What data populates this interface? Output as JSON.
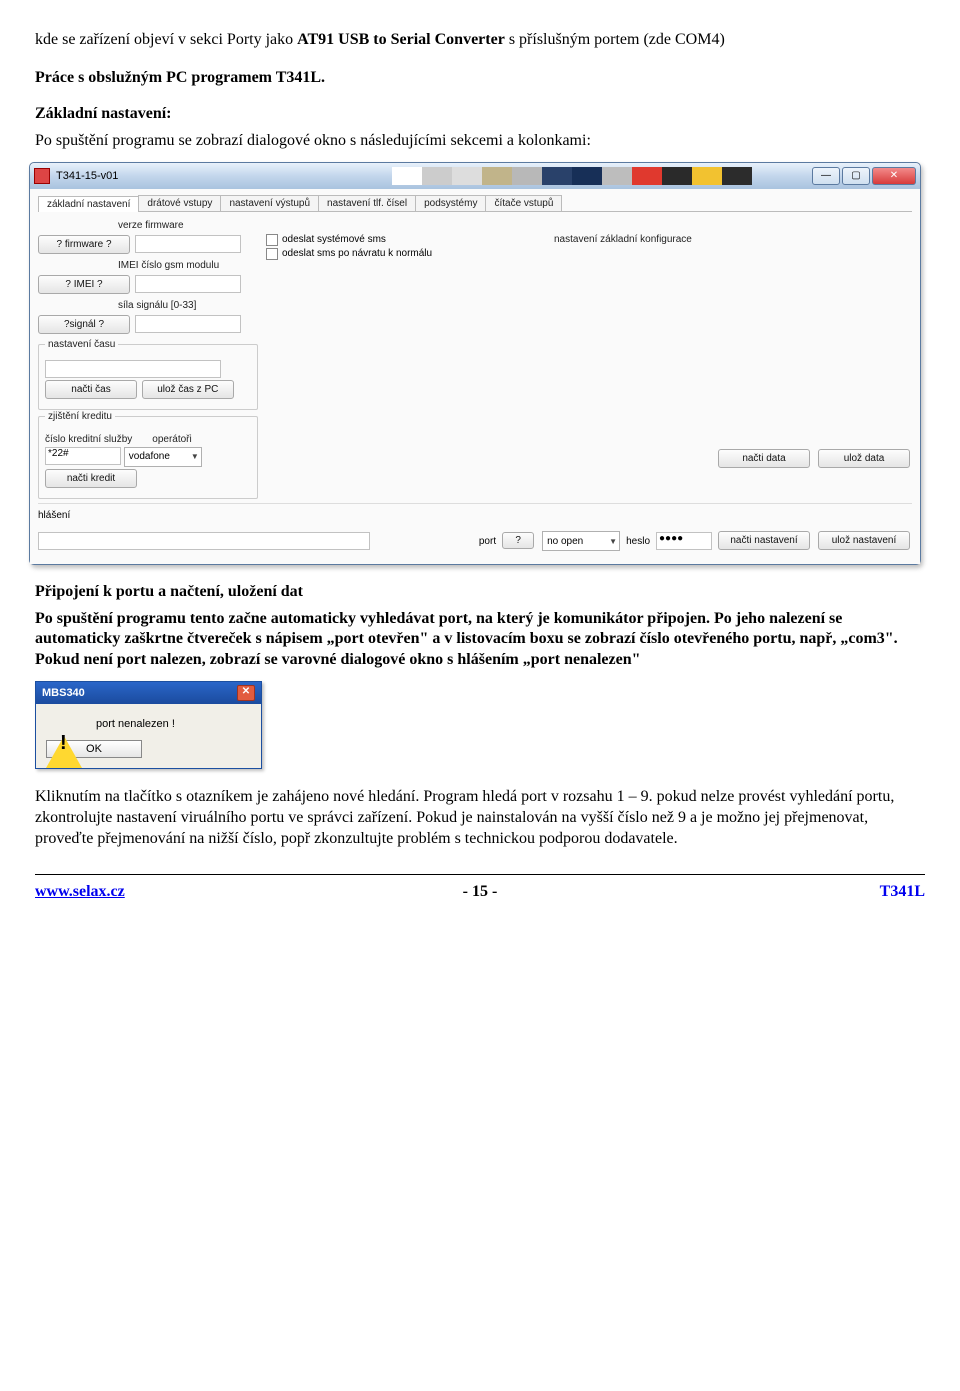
{
  "intro": {
    "line1_pre": "kde se zařízení objeví v sekci Porty jako ",
    "line1_bold": "AT91 USB to Serial Converter",
    "line1_post": " s příslušným portem (zde COM4)"
  },
  "heading1": "Práce s obslužným PC programem T341L.",
  "heading2": "Základní nastavení:",
  "para1": "Po spuštění programu se zobrazí dialogové okno s následujícími sekcemi a kolonkami:",
  "app": {
    "title": "T341-15-v01",
    "tabs": [
      "základní nastavení",
      "drátové vstupy",
      "nastavení výstupů",
      "nastavení tlf. čísel",
      "podsystémy",
      "čítače vstupů"
    ],
    "labels": {
      "verze": "verze firmware",
      "imei": "IMEI číslo gsm modulu",
      "signal": "síla signálu [0-33]",
      "cas_group": "nastavení času",
      "kredit_group": "zjištění kreditu",
      "kredit_sluzby": "číslo kreditní služby",
      "operatori": "operátoři",
      "konfig": "nastavení základní konfigurace",
      "hlaseni": "hlášení",
      "port": "port",
      "heslo": "heslo"
    },
    "buttons": {
      "firmware": "? firmware ?",
      "imei": "? IMEI ?",
      "signal": "?signál ?",
      "nacti_cas": "načti čas",
      "uloz_cas": "ulož čas z PC",
      "nacti_kredit": "načti kredit",
      "nacti_data": "načti data",
      "uloz_data": "ulož data",
      "question": "?",
      "nacti_nastaveni": "načti nastavení",
      "uloz_nastaveni": "ulož nastavení"
    },
    "checkboxes": {
      "sys_sms": "odeslat systémové sms",
      "navrat_sms": "odeslat sms po návratu k normálu"
    },
    "values": {
      "kredit_cislo": "*22#",
      "operator": "vodafone",
      "port_value": "no open",
      "heslo_value": "●●●●"
    },
    "swatch_colors": [
      "#ffffff",
      "#cccccc",
      "#dddddd",
      "#c1b48a",
      "#b8b8b8",
      "#29416a",
      "#172f57",
      "#bdbdbd",
      "#e0392e",
      "#2a2a2a",
      "#f2c230",
      "#2c2c2c"
    ]
  },
  "heading3": "Připojení k portu a načtení, uložení dat",
  "para2_pre": "Po spuštění programu tento začne automaticky vyhledávat port, na který je komunikátor připojen. Po jeho nalezení se automaticky zaškrtne čtvereček s nápisem „port otevřen\" a v listovacím boxu se zobrazí číslo otevřeného portu, např, „com3\". Pokud není port nalezen, zobrazí se varovné dialogové okno s hlášením „port nenalezen\"",
  "dialog": {
    "title": "MBS340",
    "message": "port nenalezen !",
    "ok": "OK"
  },
  "para3": "Kliknutím na tlačítko s otazníkem je zahájeno nové hledání. Program hledá port v rozsahu 1 – 9. pokud nelze provést vyhledání portu, zkontrolujte nastavení viruálního portu ve správci zařízení. Pokud je nainstalován na vyšší číslo než 9  a je možno jej přejmenovat, proveďte přejmenování na nižší číslo, popř zkonzultujte problém s technickou podporou dodavatele.",
  "footer": {
    "url": "www.selax.cz",
    "page": "- 15 -",
    "product": "T341L"
  }
}
